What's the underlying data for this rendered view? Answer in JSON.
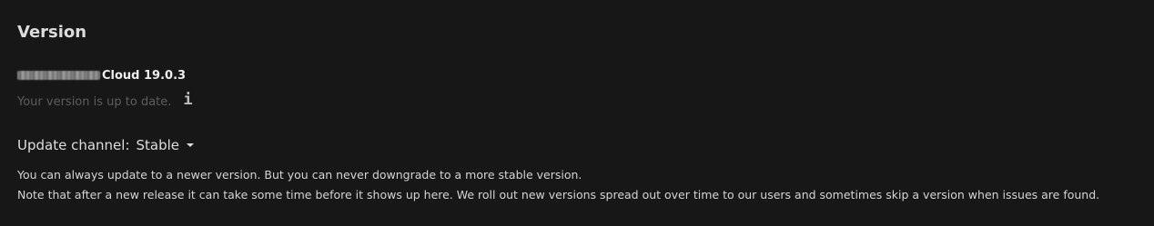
{
  "section": {
    "title": "Version"
  },
  "product": {
    "name_suffix": "Cloud 19.0.3"
  },
  "status": {
    "text": "Your version is up to date.",
    "icon": "info-icon"
  },
  "channel": {
    "label": "Update channel:",
    "selected": "Stable",
    "icon": "caret-down-icon"
  },
  "hints": {
    "line1": "You can always update to a newer version. But you can never downgrade to a more stable version.",
    "line2": "Note that after a new release it can take some time before it shows up here. We roll out new versions spread out over time to our users and sometimes skip a version when issues are found."
  }
}
